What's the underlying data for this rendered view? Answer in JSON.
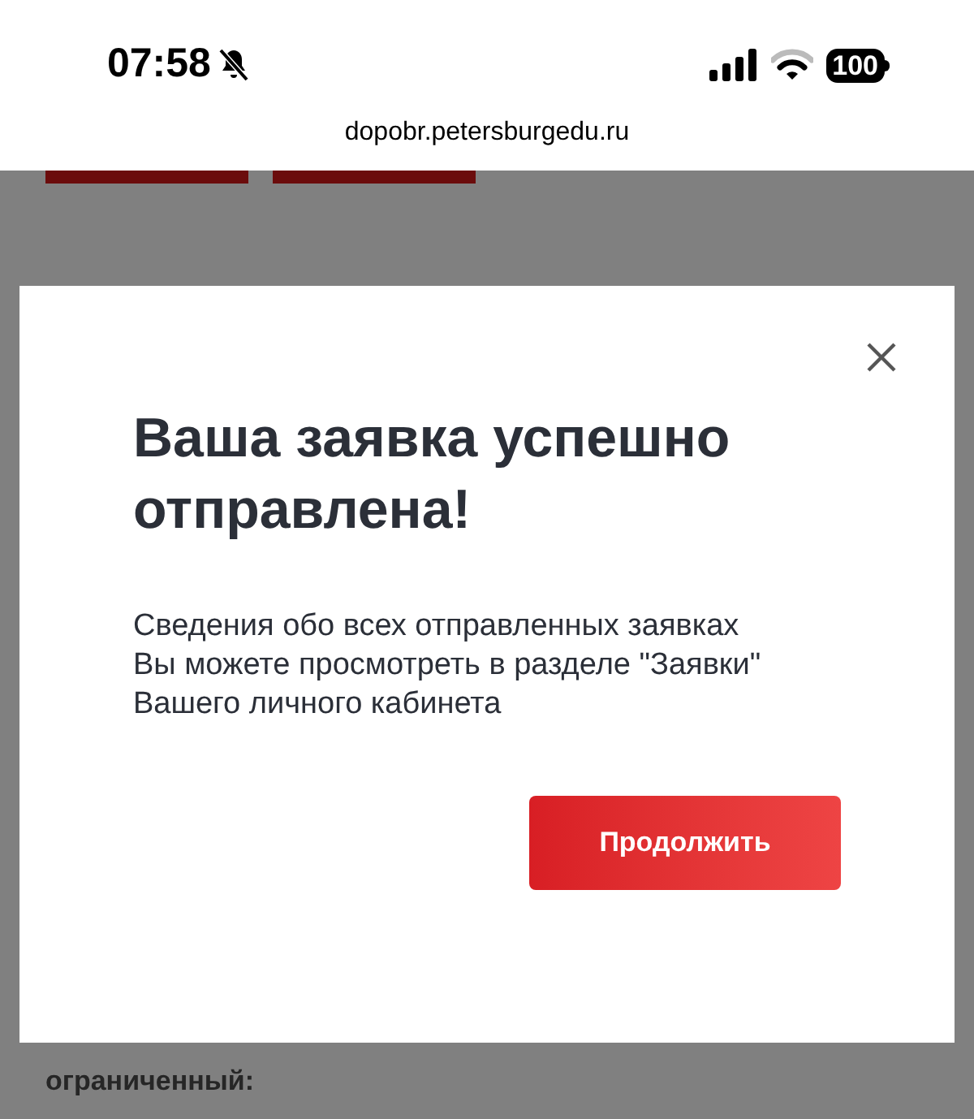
{
  "status_bar": {
    "time": "07:58",
    "battery": "100"
  },
  "address_bar": {
    "url": "dopobr.petersburgedu.ru"
  },
  "background_page": {
    "label": "ограниченный:"
  },
  "dialog": {
    "title": "Ваша заявка успешно отправлена!",
    "message": "Сведения обо всех отправленных заявках Вы можете просмотреть в разделе \"Заявки\" Вашего личного кабинета",
    "button": "Продолжить"
  }
}
